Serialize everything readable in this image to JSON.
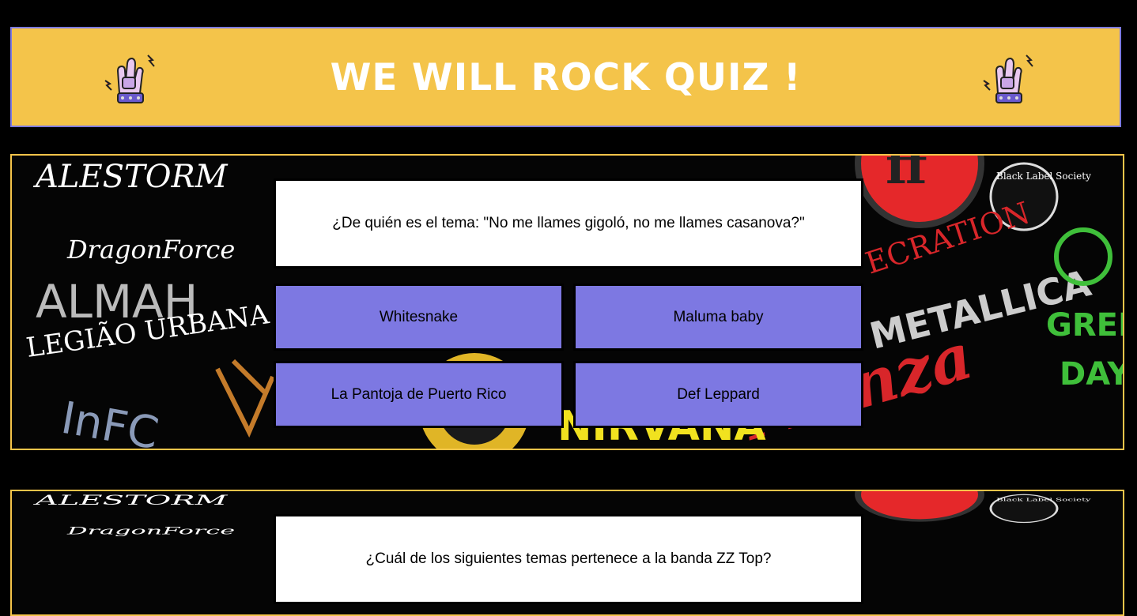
{
  "header": {
    "title": "WE WILL ROCK QUIZ !",
    "left_icon": "rock-hand-icon",
    "right_icon": "rock-hand-icon",
    "background_color": "#f4c44a",
    "border_color": "#7d7ae0"
  },
  "questions": [
    {
      "text": "¿De quién es el tema: \"No me llames gigoló, no me llames casanova?\"",
      "answers": [
        "Whitesnake",
        "Maluma baby",
        "La Pantoja de Puerto Rico",
        "Def Leppard"
      ]
    },
    {
      "text": "¿Cuál de los siguientes temas pertenece a la banda ZZ Top?"
    }
  ],
  "colors": {
    "answer_button": "#7d78e2",
    "panel_border": "#f4c44a"
  },
  "collage_labels": {
    "alestorm": "ALESTORM",
    "dragonforce": "DragonForce",
    "almah": "ALMAH",
    "legiao": "LEGIÃO URBANA",
    "metallica": "METALLICA",
    "green": "GREEN",
    "day": "DAY",
    "black_label": "Black Label Society",
    "desecration": "ECRATION",
    "nirvana": "NIRVANA"
  }
}
